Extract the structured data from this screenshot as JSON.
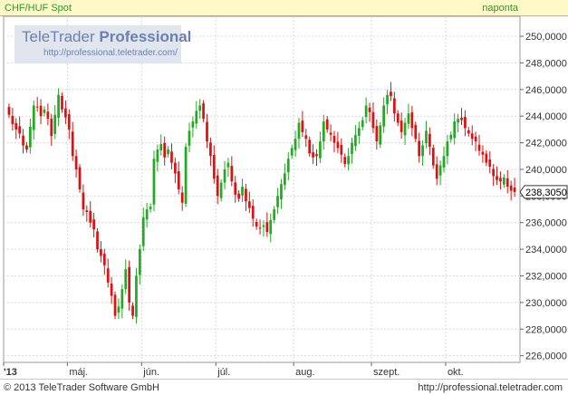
{
  "header": {
    "instrument": "CHF/HUF Spot",
    "interval": "naponta"
  },
  "logo": {
    "brand_plain": "TeleTrader",
    "brand_bold": "Professional",
    "url": "http://professional.teletrader.com/"
  },
  "footer": {
    "copyright": "© 2013 TeleTrader Software GmbH",
    "url": "http://professional.teletrader.com"
  },
  "colors": {
    "up": "#22aa22",
    "down": "#dd1111",
    "grid": "#d8d8d8",
    "axis_text": "#333333"
  },
  "chart_data": {
    "type": "candlestick",
    "ylim": [
      225.5,
      251.5
    ],
    "yticks": [
      226,
      228,
      230,
      232,
      234,
      236,
      238,
      240,
      242,
      244,
      246,
      248,
      250
    ],
    "ytick_labels": [
      "226,0000",
      "228,0000",
      "230,0000",
      "232,0000",
      "234,0000",
      "236,0000",
      "238,0000",
      "240,0000",
      "242,0000",
      "244,0000",
      "246,0000",
      "248,0000",
      "250,0000"
    ],
    "xticks": [
      {
        "label": "'13",
        "index": 0
      },
      {
        "label": "máj.",
        "index": 17
      },
      {
        "label": "jún.",
        "index": 38
      },
      {
        "label": "júl.",
        "index": 59
      },
      {
        "label": "aug.",
        "index": 81
      },
      {
        "label": "szept.",
        "index": 103
      },
      {
        "label": "okt.",
        "index": 124
      }
    ],
    "last_value": 238.305,
    "last_value_label": "238,3050",
    "grid": true,
    "series": [
      {
        "name": "CHF/HUF Spot",
        "closes": [
          244.1,
          243.4,
          243.0,
          242.7,
          241.8,
          241.5,
          243.2,
          244.8,
          244.7,
          244.0,
          244.5,
          243.8,
          242.5,
          244.1,
          245.6,
          244.5,
          243.9,
          243.0,
          241.0,
          240.0,
          238.5,
          237.0,
          236.8,
          236.0,
          235.5,
          234.0,
          233.5,
          232.8,
          231.5,
          230.5,
          229.0,
          229.7,
          231.0,
          232.5,
          230.0,
          229.0,
          232.0,
          234.0,
          236.4,
          237.0,
          237.2,
          240.8,
          241.5,
          241.9,
          240.9,
          241.5,
          240.5,
          239.7,
          238.5,
          237.5,
          241.7,
          242.9,
          243.6,
          244.4,
          244.8,
          243.8,
          242.1,
          241.0,
          239.3,
          238.0,
          239.0,
          240.0,
          240.5,
          239.1,
          238.1,
          237.8,
          238.7,
          237.6,
          237.1,
          236.3,
          235.7,
          235.6,
          235.8,
          235.3,
          236.2,
          237.0,
          238.0,
          238.9,
          239.7,
          240.8,
          241.6,
          242.3,
          243.5,
          242.8,
          242.3,
          241.2,
          240.9,
          241.0,
          242.1,
          243.6,
          243.0,
          242.6,
          242.0,
          241.6,
          241.1,
          240.4,
          241.0,
          242.0,
          242.6,
          243.1,
          243.7,
          244.8,
          244.3,
          243.1,
          242.1,
          243.3,
          244.8,
          245.6,
          245.5,
          244.2,
          243.5,
          242.8,
          243.5,
          244.2,
          243.1,
          242.3,
          241.0,
          241.8,
          242.9,
          241.7,
          240.3,
          239.3,
          240.3,
          241.0,
          242.1,
          242.6,
          243.6,
          243.8,
          243.7,
          243.1,
          242.7,
          242.3,
          242.1,
          241.4,
          241.1,
          240.5,
          240.2,
          239.5,
          239.2,
          239.1,
          239.4,
          238.7,
          238.4,
          238.3
        ]
      }
    ]
  }
}
